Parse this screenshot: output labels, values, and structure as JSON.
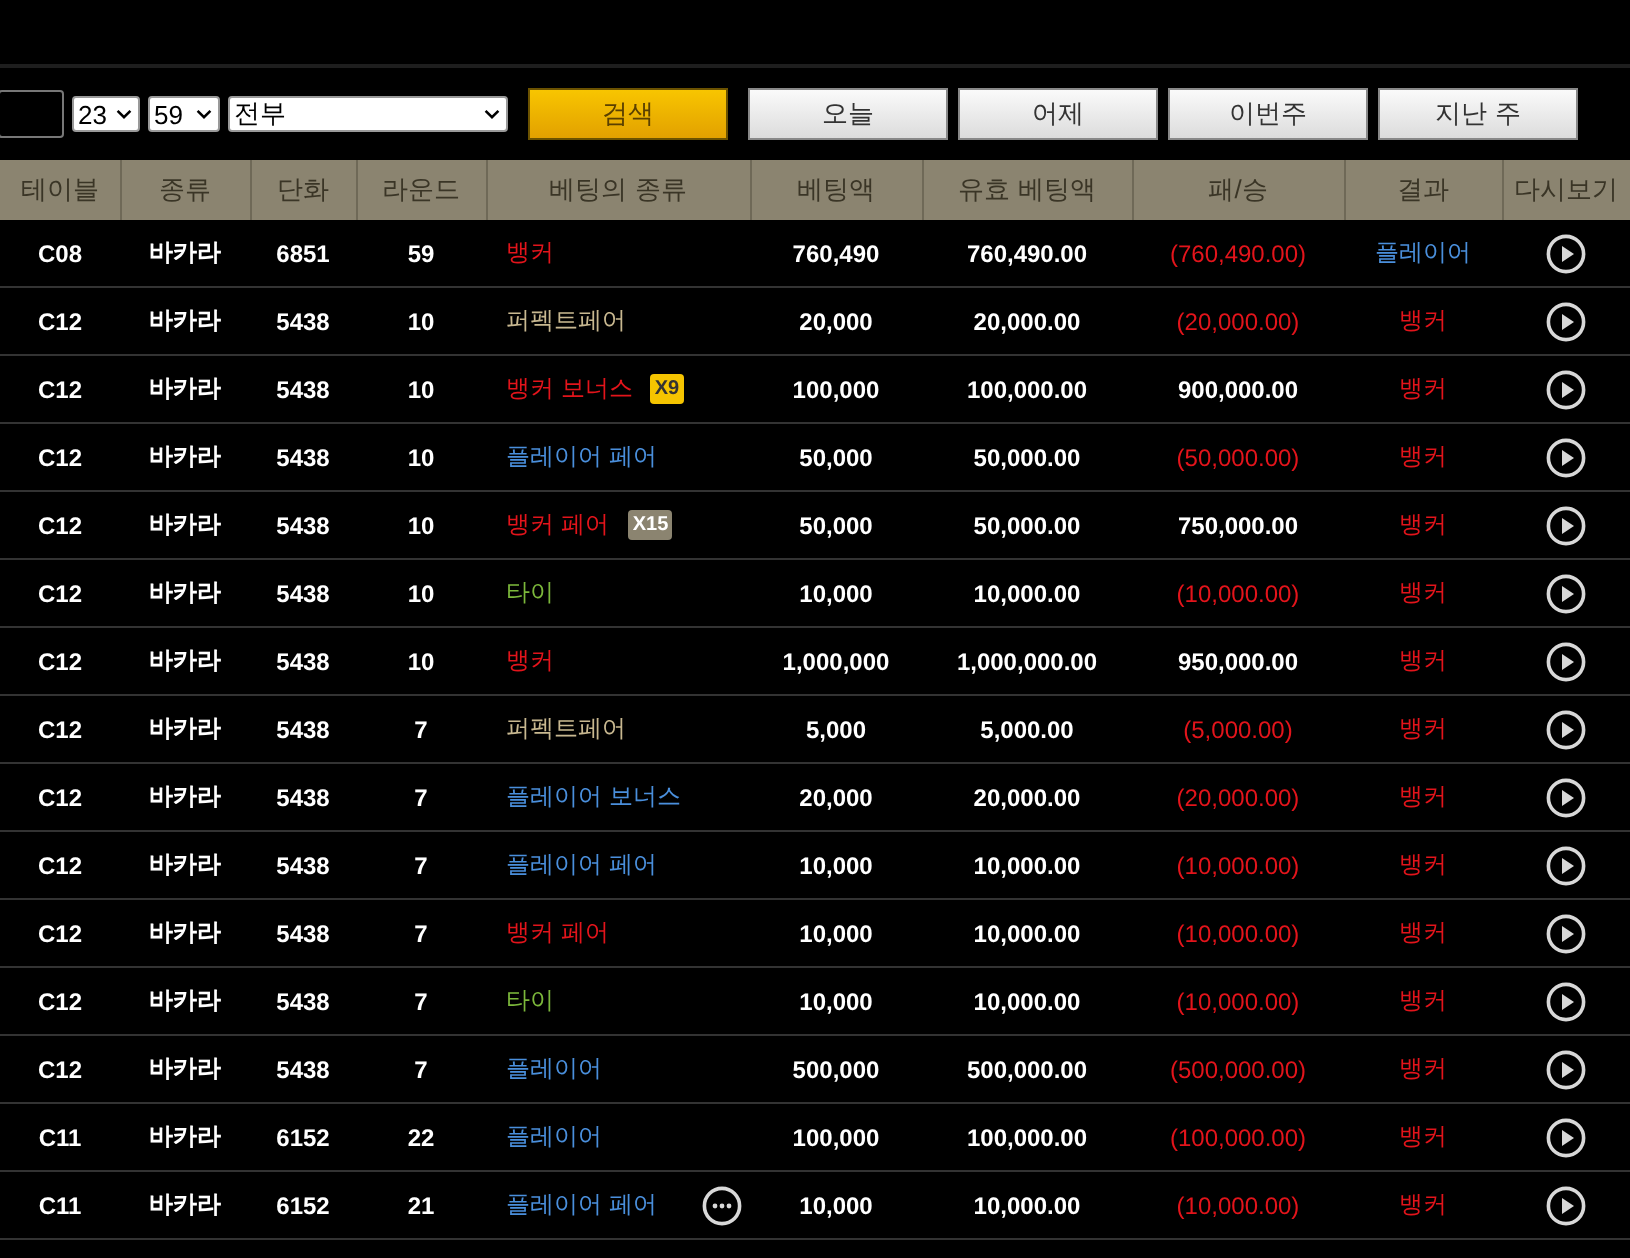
{
  "filters": {
    "hour": "23",
    "minute": "59",
    "bet_filter": "전부",
    "search_button": "검색",
    "quick_buttons": [
      "오늘",
      "어제",
      "이번주",
      "지난 주"
    ]
  },
  "table": {
    "columns": [
      "테이블",
      "종류",
      "단화",
      "라운드",
      "베팅의 종류",
      "베팅액",
      "유효 베팅액",
      "패/승",
      "결과",
      "다시보기"
    ],
    "rows": [
      {
        "table": "C08",
        "game": "바카라",
        "shoe": "6851",
        "round": "59",
        "bet": {
          "label": "뱅커",
          "kind": "banker"
        },
        "amount": "760,490",
        "valid": "760,490.00",
        "profit": {
          "text": "(760,490.00)",
          "loss": true
        },
        "result": {
          "label": "플레이어",
          "kind": "player"
        }
      },
      {
        "table": "C12",
        "game": "바카라",
        "shoe": "5438",
        "round": "10",
        "bet": {
          "label": "퍼펙트페어",
          "kind": "perfect"
        },
        "amount": "20,000",
        "valid": "20,000.00",
        "profit": {
          "text": "(20,000.00)",
          "loss": true
        },
        "result": {
          "label": "뱅커",
          "kind": "banker"
        }
      },
      {
        "table": "C12",
        "game": "바카라",
        "shoe": "5438",
        "round": "10",
        "bet": {
          "label": "뱅커 보너스",
          "kind": "banker",
          "badge": {
            "text": "X9",
            "kind": "gold"
          }
        },
        "amount": "100,000",
        "valid": "100,000.00",
        "profit": {
          "text": "900,000.00",
          "loss": false
        },
        "result": {
          "label": "뱅커",
          "kind": "banker"
        }
      },
      {
        "table": "C12",
        "game": "바카라",
        "shoe": "5438",
        "round": "10",
        "bet": {
          "label": "플레이어 페어",
          "kind": "player"
        },
        "amount": "50,000",
        "valid": "50,000.00",
        "profit": {
          "text": "(50,000.00)",
          "loss": true
        },
        "result": {
          "label": "뱅커",
          "kind": "banker"
        }
      },
      {
        "table": "C12",
        "game": "바카라",
        "shoe": "5438",
        "round": "10",
        "bet": {
          "label": "뱅커 페어",
          "kind": "banker",
          "badge": {
            "text": "X15",
            "kind": "khaki"
          }
        },
        "amount": "50,000",
        "valid": "50,000.00",
        "profit": {
          "text": "750,000.00",
          "loss": false
        },
        "result": {
          "label": "뱅커",
          "kind": "banker"
        }
      },
      {
        "table": "C12",
        "game": "바카라",
        "shoe": "5438",
        "round": "10",
        "bet": {
          "label": "타이",
          "kind": "tie"
        },
        "amount": "10,000",
        "valid": "10,000.00",
        "profit": {
          "text": "(10,000.00)",
          "loss": true
        },
        "result": {
          "label": "뱅커",
          "kind": "banker"
        }
      },
      {
        "table": "C12",
        "game": "바카라",
        "shoe": "5438",
        "round": "10",
        "bet": {
          "label": "뱅커",
          "kind": "banker"
        },
        "amount": "1,000,000",
        "valid": "1,000,000.00",
        "profit": {
          "text": "950,000.00",
          "loss": false
        },
        "result": {
          "label": "뱅커",
          "kind": "banker"
        }
      },
      {
        "table": "C12",
        "game": "바카라",
        "shoe": "5438",
        "round": "7",
        "bet": {
          "label": "퍼펙트페어",
          "kind": "perfect"
        },
        "amount": "5,000",
        "valid": "5,000.00",
        "profit": {
          "text": "(5,000.00)",
          "loss": true
        },
        "result": {
          "label": "뱅커",
          "kind": "banker"
        }
      },
      {
        "table": "C12",
        "game": "바카라",
        "shoe": "5438",
        "round": "7",
        "bet": {
          "label": "플레이어 보너스",
          "kind": "player"
        },
        "amount": "20,000",
        "valid": "20,000.00",
        "profit": {
          "text": "(20,000.00)",
          "loss": true
        },
        "result": {
          "label": "뱅커",
          "kind": "banker"
        }
      },
      {
        "table": "C12",
        "game": "바카라",
        "shoe": "5438",
        "round": "7",
        "bet": {
          "label": "플레이어 페어",
          "kind": "player"
        },
        "amount": "10,000",
        "valid": "10,000.00",
        "profit": {
          "text": "(10,000.00)",
          "loss": true
        },
        "result": {
          "label": "뱅커",
          "kind": "banker"
        }
      },
      {
        "table": "C12",
        "game": "바카라",
        "shoe": "5438",
        "round": "7",
        "bet": {
          "label": "뱅커 페어",
          "kind": "banker"
        },
        "amount": "10,000",
        "valid": "10,000.00",
        "profit": {
          "text": "(10,000.00)",
          "loss": true
        },
        "result": {
          "label": "뱅커",
          "kind": "banker"
        }
      },
      {
        "table": "C12",
        "game": "바카라",
        "shoe": "5438",
        "round": "7",
        "bet": {
          "label": "타이",
          "kind": "tie"
        },
        "amount": "10,000",
        "valid": "10,000.00",
        "profit": {
          "text": "(10,000.00)",
          "loss": true
        },
        "result": {
          "label": "뱅커",
          "kind": "banker"
        }
      },
      {
        "table": "C12",
        "game": "바카라",
        "shoe": "5438",
        "round": "7",
        "bet": {
          "label": "플레이어",
          "kind": "player"
        },
        "amount": "500,000",
        "valid": "500,000.00",
        "profit": {
          "text": "(500,000.00)",
          "loss": true
        },
        "result": {
          "label": "뱅커",
          "kind": "banker"
        }
      },
      {
        "table": "C11",
        "game": "바카라",
        "shoe": "6152",
        "round": "22",
        "bet": {
          "label": "플레이어",
          "kind": "player"
        },
        "amount": "100,000",
        "valid": "100,000.00",
        "profit": {
          "text": "(100,000.00)",
          "loss": true
        },
        "result": {
          "label": "뱅커",
          "kind": "banker"
        }
      },
      {
        "table": "C11",
        "game": "바카라",
        "shoe": "6152",
        "round": "21",
        "bet": {
          "label": "플레이어 페어",
          "kind": "player",
          "more": true
        },
        "amount": "10,000",
        "valid": "10,000.00",
        "profit": {
          "text": "(10,000.00)",
          "loss": true
        },
        "result": {
          "label": "뱅커",
          "kind": "banker"
        }
      }
    ]
  }
}
